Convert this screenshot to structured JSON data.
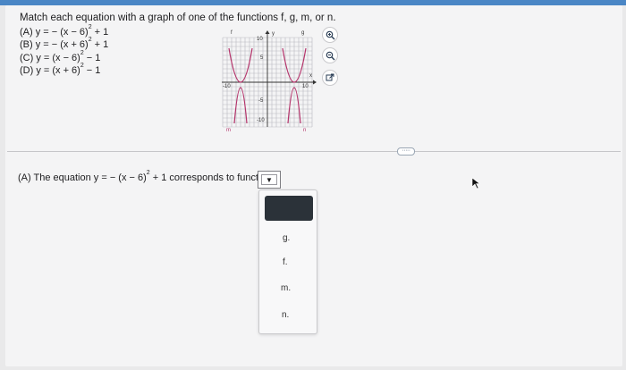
{
  "instructions": "Match each equation with a graph of one of the functions f, g, m, or n.",
  "equations": [
    {
      "label": "(A) y = − (x − 6)",
      "exp": "2",
      "tail": " + 1"
    },
    {
      "label": "(B) y = − (x + 6)",
      "exp": "2",
      "tail": " + 1"
    },
    {
      "label": "(C) y = (x − 6)",
      "exp": "2",
      "tail": " − 1"
    },
    {
      "label": "(D) y = (x + 6)",
      "exp": "2",
      "tail": " − 1"
    }
  ],
  "graph": {
    "axis_x": "x",
    "axis_y": "y",
    "label_10_top": "10",
    "label_5_top": "5",
    "label_neg10": "-10",
    "label_10_right": "10",
    "label_neg5": "-5",
    "label_neg10_bottom": "-10",
    "fn_f": "f",
    "fn_g": "g",
    "fn_m": "m",
    "fn_n": "n",
    "colors": {
      "curve": "#b5336b",
      "grid": "#b9b9c0",
      "axis": "#333333",
      "label": "#b5336b"
    }
  },
  "tools": [
    "zoom-in-icon",
    "zoom-out-icon",
    "external-link-icon"
  ],
  "more_button": "·····",
  "question": {
    "prefix": "(A) The equation y = − (x − 6)",
    "exp": "2",
    "suffix": " + 1 corresponds to function"
  },
  "dropdown": {
    "arrow": "▼",
    "options": [
      "g.",
      "f.",
      "m.",
      "n."
    ]
  }
}
